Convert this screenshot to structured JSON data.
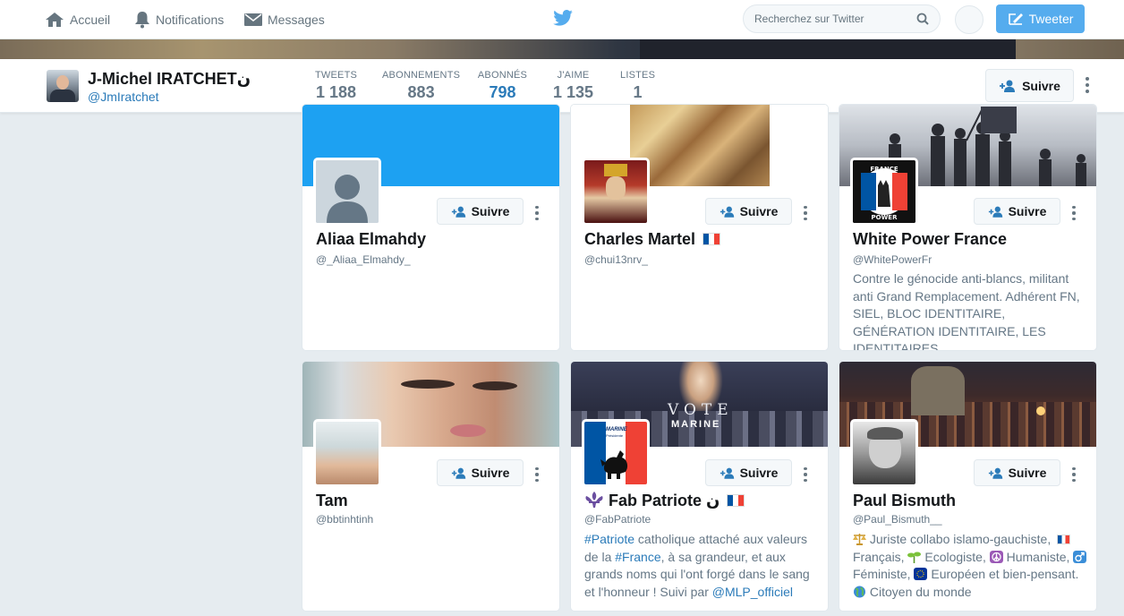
{
  "nav": {
    "home": "Accueil",
    "notifications": "Notifications",
    "messages": "Messages",
    "search_placeholder": "Recherchez sur Twitter",
    "tweet": "Tweeter"
  },
  "profile": {
    "name": "J-Michel IRATCHETن",
    "handle": "@JmIratchet",
    "follow_label": "Suivre",
    "stats": [
      {
        "label": "TWEETS",
        "value": "1 188"
      },
      {
        "label": "ABONNEMENTS",
        "value": "883"
      },
      {
        "label": "ABONNÉS",
        "value": "798"
      },
      {
        "label": "J'AIME",
        "value": "1 135"
      },
      {
        "label": "LISTES",
        "value": "1"
      }
    ]
  },
  "cards": [
    {
      "name": "Aliaa Elmahdy",
      "handle": "@_Aliaa_Elmahdy_",
      "follow": "Suivre",
      "bio": ""
    },
    {
      "name": "Charles Martel",
      "handle": "@chui13nrv_",
      "follow": "Suivre",
      "bio": ""
    },
    {
      "name": "White Power France",
      "handle": "@WhitePowerFr",
      "follow": "Suivre",
      "bio": "Contre le génocide anti-blancs, militant anti Grand Remplacement. Adhérent FN, SIEL, BLOC IDENTITAIRE, GÉNÉRATION IDENTITAIRE, LES IDENTITAIRES,…"
    },
    {
      "name": "Tam",
      "handle": "@bbtinhtinh",
      "follow": "Suivre",
      "bio": ""
    },
    {
      "name": "Fab Patriote ن",
      "handle": "@FabPatriote",
      "follow": "Suivre",
      "bio_parts": {
        "tag1": "#Patriote",
        "t1": " catholique attaché aux valeurs de la ",
        "tag2": "#France",
        "t2": ", à sa grandeur, et aux grands noms qui l'ont forgé dans le sang et l'honneur ! Suivi par ",
        "tag3": "@MLP_officiel"
      }
    },
    {
      "name": "Paul Bismuth",
      "handle": "@Paul_Bismuth__",
      "follow": "Suivre",
      "bio_parts": {
        "p1": " Juriste collabo islamo-gauchiste, ",
        "p2": " Français, ",
        "p3": " Ecologiste, ",
        "p4": " Humaniste, ",
        "p5": " Féministe, ",
        "p6": " Européen et bien-pensant. ",
        "p7": " Citoyen du monde"
      }
    }
  ],
  "card_covers": {
    "vote_marine": "VOTE",
    "vote_marine_2": "MARINE",
    "france_power_1": "FRANCE",
    "france_power_2": "POWER",
    "marine_logo": "MARINE",
    "marine_logo_sub": "Présidente"
  },
  "colors": {
    "accent": "#2b7bb9",
    "tweet_button": "#55acee",
    "cover_blue": "#1da1f2"
  }
}
